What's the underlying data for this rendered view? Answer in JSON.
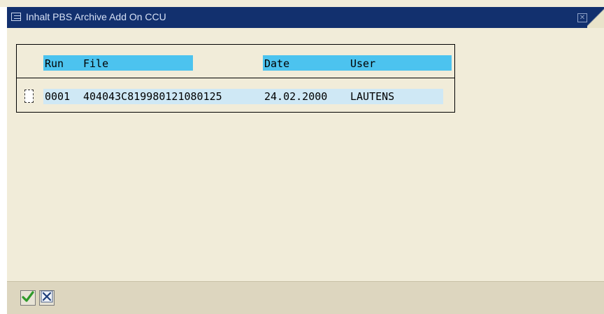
{
  "window": {
    "title": "Inhalt PBS Archive Add On CCU",
    "close_icon": "close-icon"
  },
  "table": {
    "columns": [
      {
        "key": "run",
        "label": "Run"
      },
      {
        "key": "file",
        "label": "File"
      },
      {
        "key": "date",
        "label": "Date"
      },
      {
        "key": "user",
        "label": "User"
      }
    ],
    "rows": [
      {
        "run": "0001",
        "file": "404043C819980121080125",
        "date": "24.02.2000",
        "user": "LAUTENS",
        "selected": false
      }
    ]
  },
  "toolbar": {
    "confirm_icon": "checkmark-icon",
    "cancel_icon": "cancel-icon"
  },
  "colors": {
    "titlebar": "#12306e",
    "background": "#f1ecd9",
    "header_highlight": "#4cc3ef",
    "row_highlight": "#cfe8f5",
    "confirm_green": "#2f9a2a"
  }
}
